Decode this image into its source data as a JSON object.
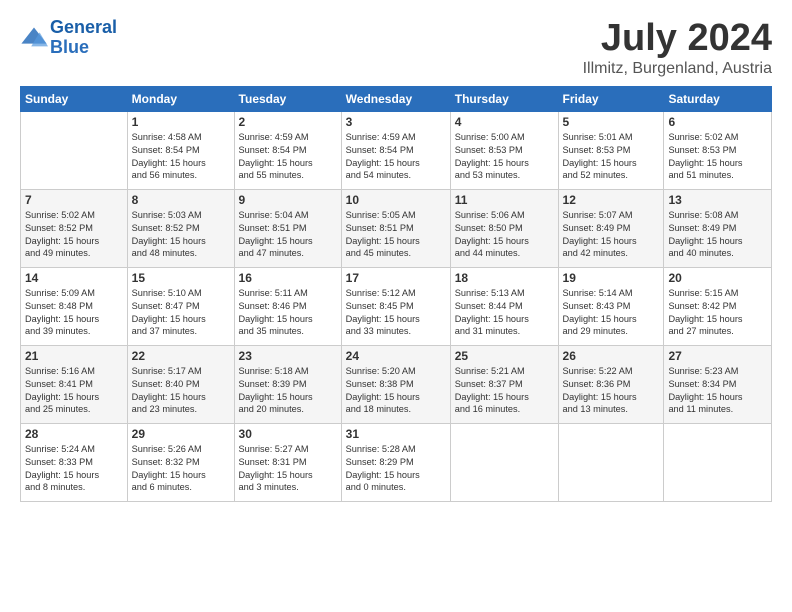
{
  "header": {
    "logo_line1": "General",
    "logo_line2": "Blue",
    "title": "July 2024",
    "subtitle": "Illmitz, Burgenland, Austria"
  },
  "calendar": {
    "days_of_week": [
      "Sunday",
      "Monday",
      "Tuesday",
      "Wednesday",
      "Thursday",
      "Friday",
      "Saturday"
    ],
    "weeks": [
      [
        {
          "day": "",
          "info": ""
        },
        {
          "day": "1",
          "info": "Sunrise: 4:58 AM\nSunset: 8:54 PM\nDaylight: 15 hours\nand 56 minutes."
        },
        {
          "day": "2",
          "info": "Sunrise: 4:59 AM\nSunset: 8:54 PM\nDaylight: 15 hours\nand 55 minutes."
        },
        {
          "day": "3",
          "info": "Sunrise: 4:59 AM\nSunset: 8:54 PM\nDaylight: 15 hours\nand 54 minutes."
        },
        {
          "day": "4",
          "info": "Sunrise: 5:00 AM\nSunset: 8:53 PM\nDaylight: 15 hours\nand 53 minutes."
        },
        {
          "day": "5",
          "info": "Sunrise: 5:01 AM\nSunset: 8:53 PM\nDaylight: 15 hours\nand 52 minutes."
        },
        {
          "day": "6",
          "info": "Sunrise: 5:02 AM\nSunset: 8:53 PM\nDaylight: 15 hours\nand 51 minutes."
        }
      ],
      [
        {
          "day": "7",
          "info": "Sunrise: 5:02 AM\nSunset: 8:52 PM\nDaylight: 15 hours\nand 49 minutes."
        },
        {
          "day": "8",
          "info": "Sunrise: 5:03 AM\nSunset: 8:52 PM\nDaylight: 15 hours\nand 48 minutes."
        },
        {
          "day": "9",
          "info": "Sunrise: 5:04 AM\nSunset: 8:51 PM\nDaylight: 15 hours\nand 47 minutes."
        },
        {
          "day": "10",
          "info": "Sunrise: 5:05 AM\nSunset: 8:51 PM\nDaylight: 15 hours\nand 45 minutes."
        },
        {
          "day": "11",
          "info": "Sunrise: 5:06 AM\nSunset: 8:50 PM\nDaylight: 15 hours\nand 44 minutes."
        },
        {
          "day": "12",
          "info": "Sunrise: 5:07 AM\nSunset: 8:49 PM\nDaylight: 15 hours\nand 42 minutes."
        },
        {
          "day": "13",
          "info": "Sunrise: 5:08 AM\nSunset: 8:49 PM\nDaylight: 15 hours\nand 40 minutes."
        }
      ],
      [
        {
          "day": "14",
          "info": "Sunrise: 5:09 AM\nSunset: 8:48 PM\nDaylight: 15 hours\nand 39 minutes."
        },
        {
          "day": "15",
          "info": "Sunrise: 5:10 AM\nSunset: 8:47 PM\nDaylight: 15 hours\nand 37 minutes."
        },
        {
          "day": "16",
          "info": "Sunrise: 5:11 AM\nSunset: 8:46 PM\nDaylight: 15 hours\nand 35 minutes."
        },
        {
          "day": "17",
          "info": "Sunrise: 5:12 AM\nSunset: 8:45 PM\nDaylight: 15 hours\nand 33 minutes."
        },
        {
          "day": "18",
          "info": "Sunrise: 5:13 AM\nSunset: 8:44 PM\nDaylight: 15 hours\nand 31 minutes."
        },
        {
          "day": "19",
          "info": "Sunrise: 5:14 AM\nSunset: 8:43 PM\nDaylight: 15 hours\nand 29 minutes."
        },
        {
          "day": "20",
          "info": "Sunrise: 5:15 AM\nSunset: 8:42 PM\nDaylight: 15 hours\nand 27 minutes."
        }
      ],
      [
        {
          "day": "21",
          "info": "Sunrise: 5:16 AM\nSunset: 8:41 PM\nDaylight: 15 hours\nand 25 minutes."
        },
        {
          "day": "22",
          "info": "Sunrise: 5:17 AM\nSunset: 8:40 PM\nDaylight: 15 hours\nand 23 minutes."
        },
        {
          "day": "23",
          "info": "Sunrise: 5:18 AM\nSunset: 8:39 PM\nDaylight: 15 hours\nand 20 minutes."
        },
        {
          "day": "24",
          "info": "Sunrise: 5:20 AM\nSunset: 8:38 PM\nDaylight: 15 hours\nand 18 minutes."
        },
        {
          "day": "25",
          "info": "Sunrise: 5:21 AM\nSunset: 8:37 PM\nDaylight: 15 hours\nand 16 minutes."
        },
        {
          "day": "26",
          "info": "Sunrise: 5:22 AM\nSunset: 8:36 PM\nDaylight: 15 hours\nand 13 minutes."
        },
        {
          "day": "27",
          "info": "Sunrise: 5:23 AM\nSunset: 8:34 PM\nDaylight: 15 hours\nand 11 minutes."
        }
      ],
      [
        {
          "day": "28",
          "info": "Sunrise: 5:24 AM\nSunset: 8:33 PM\nDaylight: 15 hours\nand 8 minutes."
        },
        {
          "day": "29",
          "info": "Sunrise: 5:26 AM\nSunset: 8:32 PM\nDaylight: 15 hours\nand 6 minutes."
        },
        {
          "day": "30",
          "info": "Sunrise: 5:27 AM\nSunset: 8:31 PM\nDaylight: 15 hours\nand 3 minutes."
        },
        {
          "day": "31",
          "info": "Sunrise: 5:28 AM\nSunset: 8:29 PM\nDaylight: 15 hours\nand 0 minutes."
        },
        {
          "day": "",
          "info": ""
        },
        {
          "day": "",
          "info": ""
        },
        {
          "day": "",
          "info": ""
        }
      ]
    ]
  }
}
